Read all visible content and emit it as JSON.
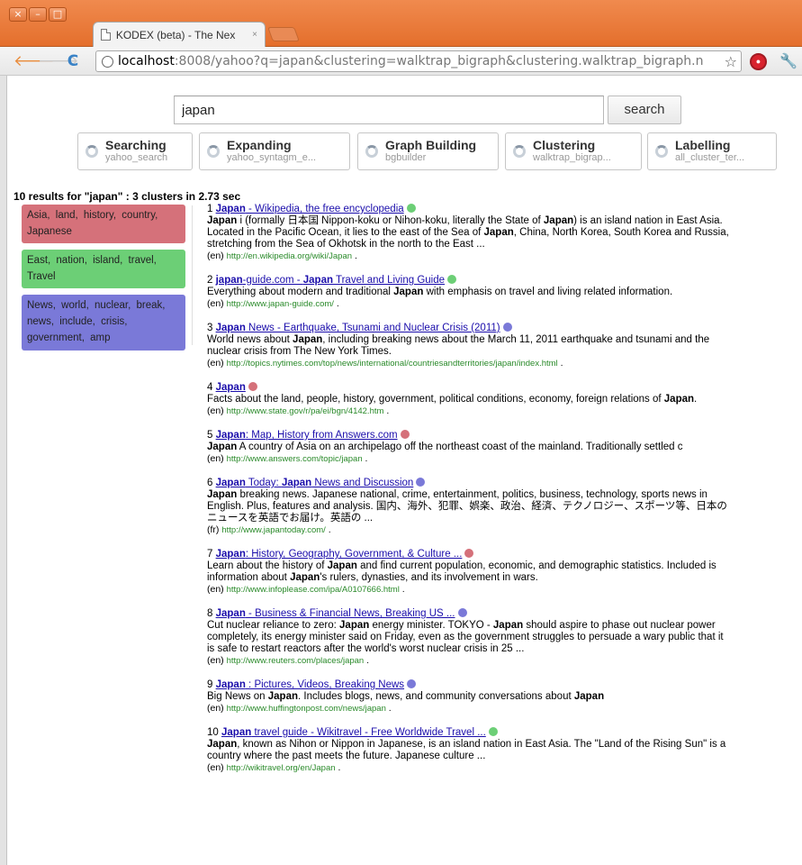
{
  "browser": {
    "window_controls": [
      "×",
      "–",
      "□"
    ],
    "tab_title": "KODEX (beta) - The Nex",
    "tab_close": "×",
    "url_host": "localhost",
    "url_rest": ":8008/yahoo?q=japan&clustering=walktrap_bigraph&clustering.walktrap_bigraph.n",
    "nav": {
      "back": "🡐",
      "forward": "🡒",
      "reload": "C"
    }
  },
  "search": {
    "query": "japan",
    "button_label": "search"
  },
  "stages": [
    {
      "title": "Searching",
      "sub": "yahoo_search"
    },
    {
      "title": "Expanding",
      "sub": "yahoo_syntagm_e..."
    },
    {
      "title": "Graph Building",
      "sub": "bgbuilder"
    },
    {
      "title": "Clustering",
      "sub": "walktrap_bigrap..."
    },
    {
      "title": "Labelling",
      "sub": "all_cluster_ter..."
    }
  ],
  "summary": "10 results for \"japan\" : 3 clusters in 2.73 sec",
  "colors": {
    "red": "#d5717a",
    "green": "#6ccf76",
    "blue": "#7a79d8"
  },
  "clusters": [
    {
      "label": "Asia, land, history, country, Japanese",
      "color": "#d5717a"
    },
    {
      "label": "East, nation, island, travel, Travel",
      "color": "#6ccf76"
    },
    {
      "label": "News, world, nuclear, break, news, include, crisis, government, amp",
      "color": "#7a79d8"
    }
  ],
  "results": [
    {
      "num": "1",
      "title_html": "<b>Japan</b> - Wikipedia, the free encyclopedia",
      "dot": "#6ccf76",
      "snippet_html": "<b>Japan</b> i (formally 日本国 Nippon-koku or Nihon-koku, literally the State of <b>Japan</b>) is an island nation in East Asia. Located in the Pacific Ocean, it lies to the east of the Sea of <b>Japan</b>, China, North Korea, South Korea and Russia, stretching from the Sea of Okhotsk in the north to the East ...",
      "lang": "(en)",
      "url": "http://en.wikipedia.org/wiki/Japan"
    },
    {
      "num": "2",
      "title_html": "<b>japan</b>-guide.com - <b>Japan</b> Travel and Living Guide",
      "dot": "#6ccf76",
      "snippet_html": "Everything about modern and traditional <b>Japan</b> with emphasis on travel and living related information.",
      "lang": "(en)",
      "url": "http://www.japan-guide.com/"
    },
    {
      "num": "3",
      "title_html": "<b>Japan</b> News - Earthquake, Tsunami and Nuclear Crisis (2011)",
      "dot": "#7a79d8",
      "snippet_html": "World news about <b>Japan</b>, including breaking news about the March 11, 2011 earthquake and tsunami and the nuclear crisis from The New York Times.",
      "lang": "(en)",
      "url": "http://topics.nytimes.com/top/news/international/countriesandterritories/japan/index.html"
    },
    {
      "num": "4",
      "title_html": "<b>Japan</b>",
      "dot": "#d5717a",
      "snippet_html": "Facts about the land, people, history, government, political conditions, economy, foreign relations of <b>Japan</b>.",
      "lang": "(en)",
      "url": "http://www.state.gov/r/pa/ei/bgn/4142.htm"
    },
    {
      "num": "5",
      "title_html": "<b>Japan</b>: Map, History from Answers.com",
      "dot": "#d5717a",
      "snippet_html": "<b>Japan</b> A country of Asia on an archipelago off the northeast coast of the mainland. Traditionally settled c",
      "lang": "(en)",
      "url": "http://www.answers.com/topic/japan"
    },
    {
      "num": "6",
      "title_html": "<b>Japan</b> Today: <b>Japan</b> News and Discussion",
      "dot": "#7a79d8",
      "snippet_html": "<b>Japan</b> breaking news. Japanese national, crime, entertainment, politics, business, technology, sports news in English. Plus, features and analysis. 国内、海外、犯罪、娯楽、政治、経済、テクノロジー、スポーツ等、日本のニュースを英語でお届け。英語の ...",
      "lang": "(fr)",
      "url": "http://www.japantoday.com/"
    },
    {
      "num": "7",
      "title_html": "<b>Japan</b>: History, Geography, Government, &amp; Culture ...",
      "dot": "#d5717a",
      "snippet_html": "Learn about the history of <b>Japan</b> and find current population, economic, and demographic statistics. Included is information about <b>Japan</b>'s rulers, dynasties, and its involvement in wars.",
      "lang": "(en)",
      "url": "http://www.infoplease.com/ipa/A0107666.html"
    },
    {
      "num": "8",
      "title_html": "<b>Japan</b> - Business &amp; Financial News, Breaking US ...",
      "dot": "#7a79d8",
      "snippet_html": "Cut nuclear reliance to zero: <b>Japan</b> energy minister. TOKYO - <b>Japan</b> should aspire to phase out nuclear power completely, its energy minister said on Friday, even as the government struggles to persuade a wary public that it is safe to restart reactors after the world's worst nuclear crisis in 25 ...",
      "lang": "(en)",
      "url": "http://www.reuters.com/places/japan"
    },
    {
      "num": "9",
      "title_html": "<b>Japan</b> : Pictures, Videos, Breaking News",
      "dot": "#7a79d8",
      "snippet_html": "Big News on <b>Japan</b>. Includes blogs, news, and community conversations about <b>Japan</b>",
      "lang": "(en)",
      "url": "http://www.huffingtonpost.com/news/japan"
    },
    {
      "num": "10",
      "title_html": "<b>Japan</b> travel guide - Wikitravel - Free Worldwide Travel ...",
      "dot": "#6ccf76",
      "snippet_html": "<b>Japan</b>, known as Nihon or Nippon in Japanese, is an island nation in East Asia. The \"Land of the Rising Sun\" is a country where the past meets the future. Japanese culture ...",
      "lang": "(en)",
      "url": "http://wikitravel.org/en/Japan"
    }
  ]
}
